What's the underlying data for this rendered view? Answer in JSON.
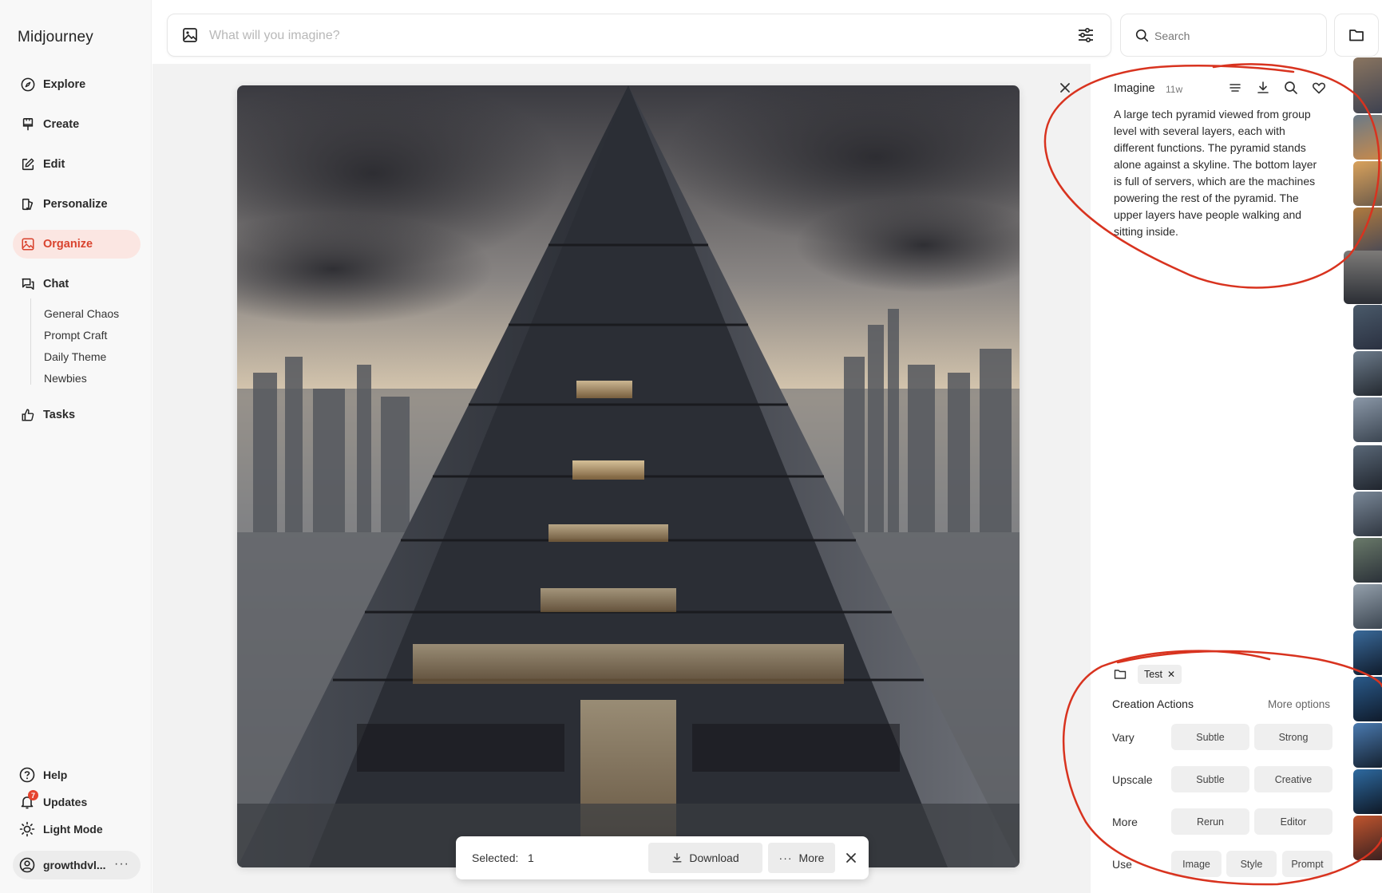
{
  "app": {
    "name": "Midjourney"
  },
  "nav": [
    {
      "label": "Explore",
      "icon": "compass-icon"
    },
    {
      "label": "Create",
      "icon": "paintbrush-icon"
    },
    {
      "label": "Edit",
      "icon": "edit-icon"
    },
    {
      "label": "Personalize",
      "icon": "personalize-icon"
    },
    {
      "label": "Organize",
      "icon": "image-icon",
      "active": true
    },
    {
      "label": "Chat",
      "icon": "chat-icon"
    }
  ],
  "chat_rooms": [
    "General Chaos",
    "Prompt Craft",
    "Daily Theme",
    "Newbies"
  ],
  "tasks": {
    "label": "Tasks",
    "icon": "thumbs-up-icon"
  },
  "bottom": {
    "help": "Help",
    "updates": "Updates",
    "updates_badge": "7",
    "light_mode": "Light Mode",
    "user": "growthdvl...",
    "user_more": "···"
  },
  "prompt_bar": {
    "placeholder": "What will you imagine?"
  },
  "search": {
    "placeholder": "Search"
  },
  "selection": {
    "label": "Selected:",
    "count": "1",
    "download": "Download",
    "more": "More"
  },
  "detail": {
    "title": "Imagine",
    "age": "11w",
    "prompt": "A large tech pyramid viewed from group level with several layers, each with different functions. The pyramid stands alone against a skyline. The bottom layer is full of servers, which are the machines powering the rest of the pyramid. The upper layers have people walking and sitting inside.",
    "folder_tag": "Test",
    "creation_actions": "Creation Actions",
    "more_options": "More options",
    "rows": [
      {
        "label": "Vary",
        "buttons": [
          "Subtle",
          "Strong"
        ]
      },
      {
        "label": "Upscale",
        "buttons": [
          "Subtle",
          "Creative"
        ]
      },
      {
        "label": "More",
        "buttons": [
          "Rerun",
          "Editor"
        ]
      },
      {
        "label": "Use",
        "buttons": [
          "Image",
          "Style",
          "Prompt"
        ]
      }
    ]
  },
  "colors": {
    "accent": "#d9432e",
    "active_bg": "#fbe6e2",
    "annotation": "#d8331f",
    "sidebar_bg": "#f8f8f8"
  }
}
